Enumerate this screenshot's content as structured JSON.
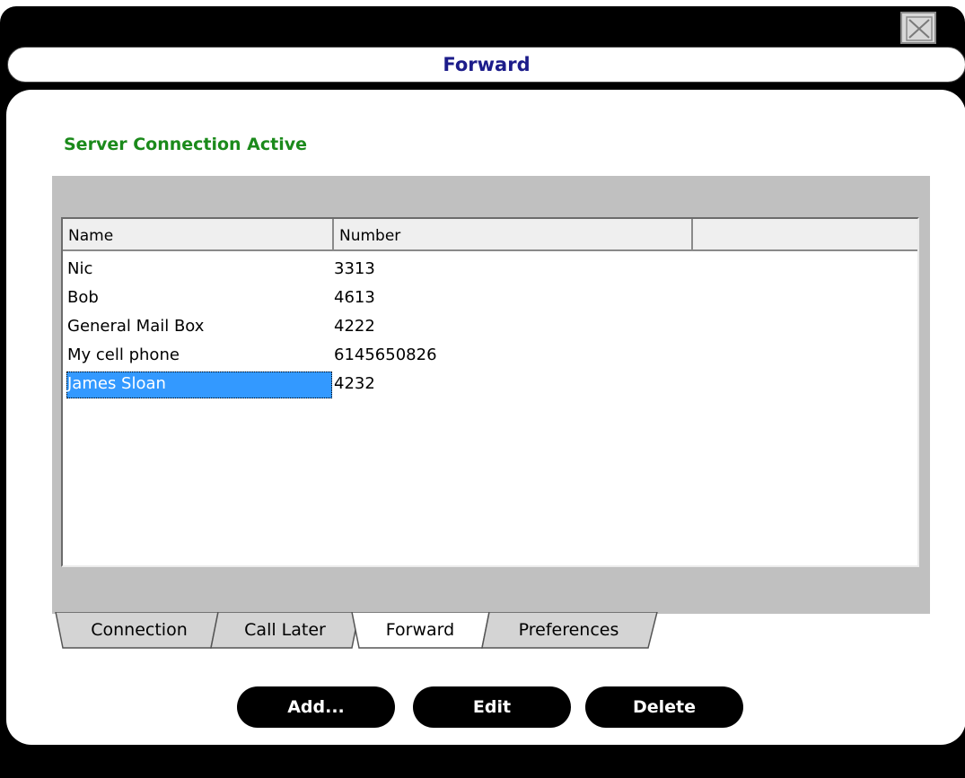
{
  "window": {
    "title": "Forward",
    "close_icon": "close-x-icon"
  },
  "status": {
    "text": "Server Connection Active",
    "color": "#1b8a1b"
  },
  "list": {
    "columns": [
      "Name",
      "Number",
      ""
    ],
    "rows": [
      {
        "name": "Nic",
        "number": "3313"
      },
      {
        "name": "Bob",
        "number": "4613"
      },
      {
        "name": "General Mail Box",
        "number": "4222"
      },
      {
        "name": "My cell phone",
        "number": "6145650826"
      },
      {
        "name": "James Sloan",
        "number": "4232"
      }
    ],
    "selected_row": "James Sloan",
    "selection_color": "#3399ff"
  },
  "tabs": [
    {
      "label": "Connection",
      "active": false
    },
    {
      "label": "Call Later",
      "active": false
    },
    {
      "label": "Forward",
      "active": true
    },
    {
      "label": "Preferences",
      "active": false
    }
  ],
  "buttons": {
    "add": "Add...",
    "edit": "Edit",
    "delete": "Delete"
  },
  "colors": {
    "title_text": "#1c1c8a",
    "frame": "#000000",
    "grey_area": "#c0c0c0"
  }
}
